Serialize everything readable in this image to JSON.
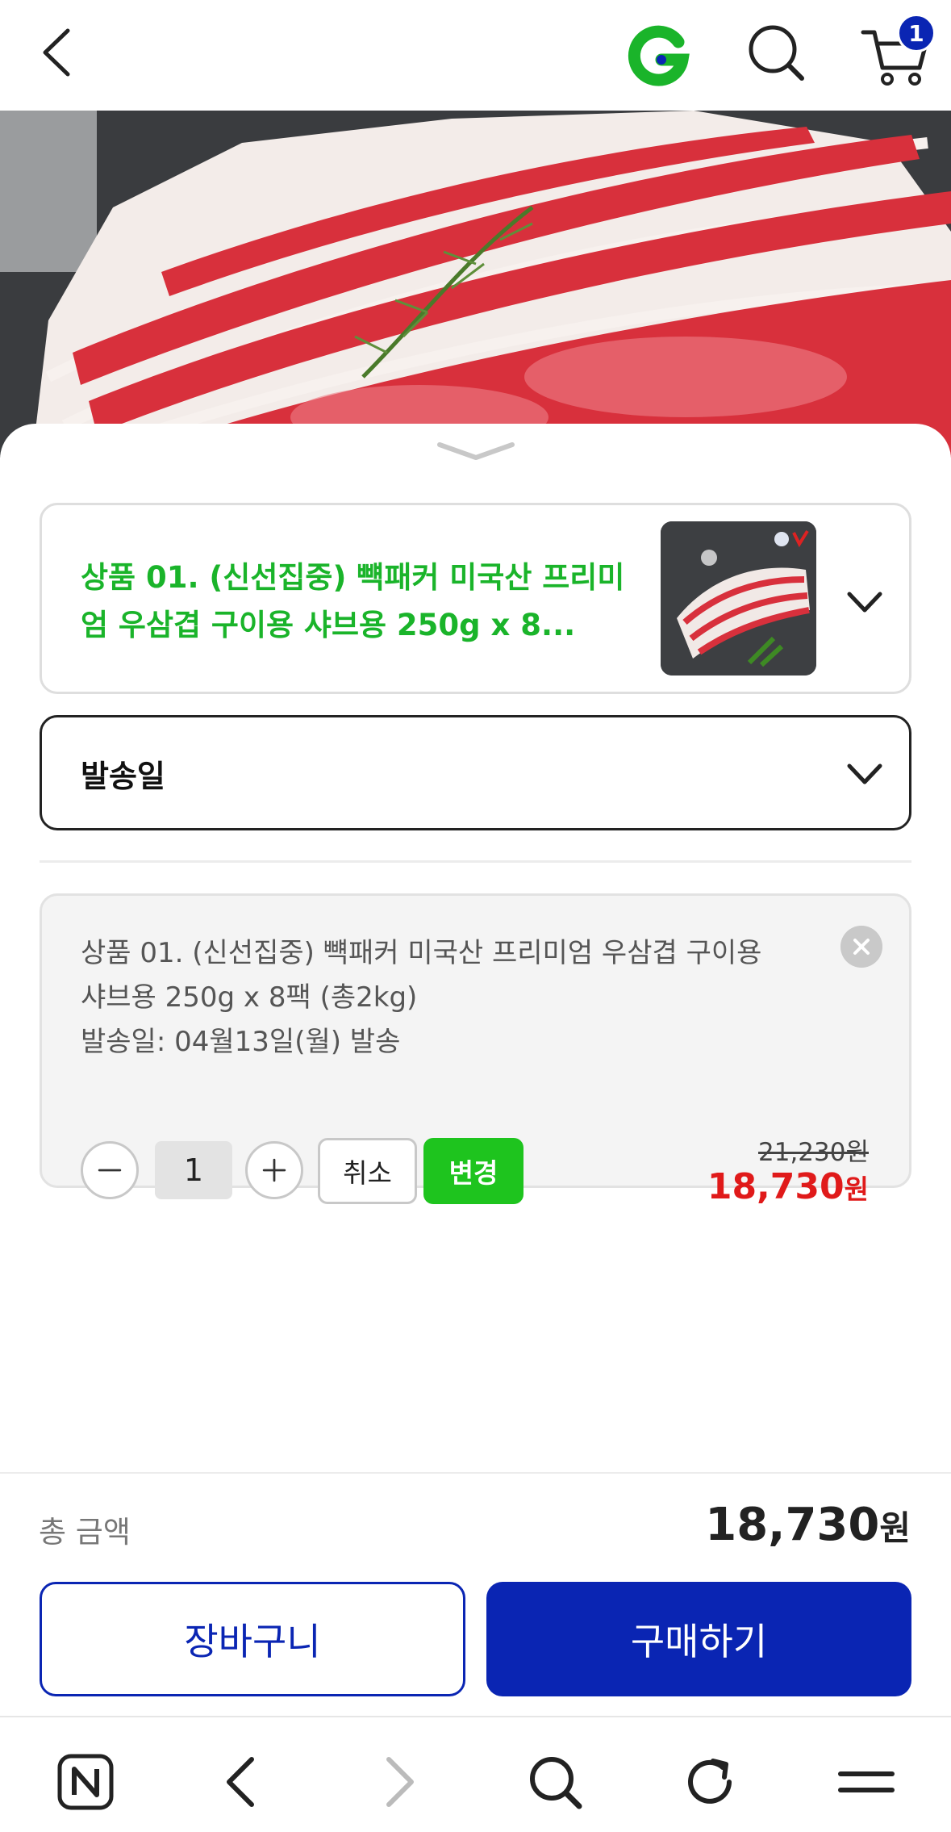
{
  "header": {
    "cart_count": "1"
  },
  "product_select": {
    "name": "상품 01. (신선집중) 뺵패커 미국산 프리미엄 우삼겹 구이용 샤브용 250g x 8..."
  },
  "date_select": {
    "label": "발송일"
  },
  "order_item": {
    "description_line1": "상품 01. (신선집중) 뺵패커 미국산 프리미엄 우삼겹 구이용",
    "description_line2": "샤브용 250g x 8팩 (총2kg)",
    "ship_date": "발송일: 04월13일(월) 발송",
    "quantity": "1",
    "cancel_label": "취소",
    "change_label": "변경",
    "original_price": "21,230원",
    "sale_price_number": "18,730",
    "sale_price_unit": "원"
  },
  "total": {
    "label": "총 금액",
    "value_number": "18,730",
    "value_unit": "원"
  },
  "actions": {
    "cart_label": "장바구니",
    "buy_label": "구매하기"
  },
  "colors": {
    "brand_green": "#1ab42a",
    "primary_blue": "#0a25b3",
    "sale_red": "#e01a1a"
  }
}
